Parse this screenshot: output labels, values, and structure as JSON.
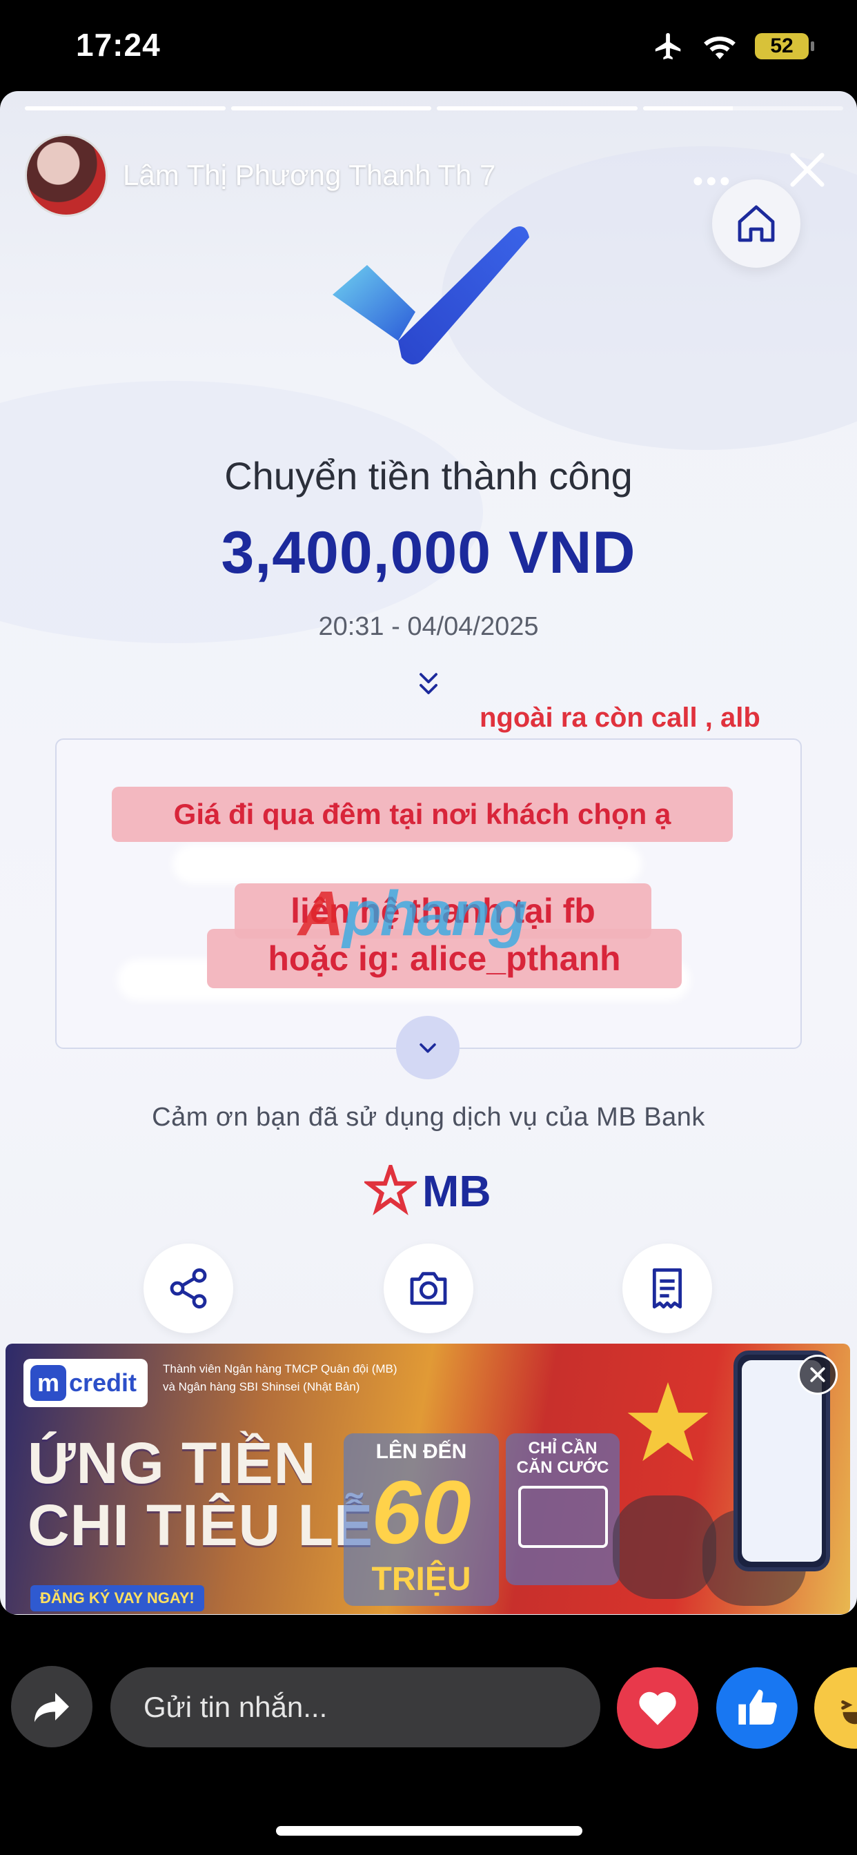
{
  "status_bar": {
    "time": "17:24",
    "battery": "52",
    "icons": [
      "airplane-icon",
      "wifi-icon",
      "battery-icon"
    ]
  },
  "story": {
    "progress": [
      1.0,
      1.0,
      1.0,
      0.45
    ],
    "user_name": "Lâm Thị Phương Thanh",
    "posted": "Th 7",
    "more_label": "•••"
  },
  "receipt": {
    "title": "Chuyển tiền thành công",
    "amount": "3,400,000 VND",
    "datetime": "20:31 - 04/04/2025",
    "thanks": "Cảm ơn bạn đã sử dụng dịch vụ của MB Bank",
    "bank_logo_text": "MB",
    "accent_color": "#1c2a9c"
  },
  "overlay_text": {
    "annotation": "ngoài ra còn call , alb",
    "price_note": "Giá đi qua đêm tại nơi khách chọn ạ",
    "contact_line1": "liên hệ thanh tại fb",
    "contact_line2": "hoặc ig: alice_pthanh",
    "watermark": "Aphang"
  },
  "banner": {
    "logo_m": "m",
    "logo_text": "credit",
    "small_line1": "Thành viên Ngân hàng TMCP Quân đội (MB)",
    "small_line2": "và Ngân hàng SBI Shinsei (Nhật Bản)",
    "headline_line1": "ỨNG TIỀN",
    "headline_line2": "CHI TIÊU LỄ",
    "cta": "ĐĂNG KÝ VAY NGAY!",
    "box1_top": "LÊN ĐẾN",
    "box1_value": "60",
    "box1_unit": "TRIỆU",
    "box2_line1": "CHỈ CẦN",
    "box2_line2": "CĂN CƯỚC"
  },
  "reply": {
    "placeholder": "Gửi tin nhắn..."
  }
}
